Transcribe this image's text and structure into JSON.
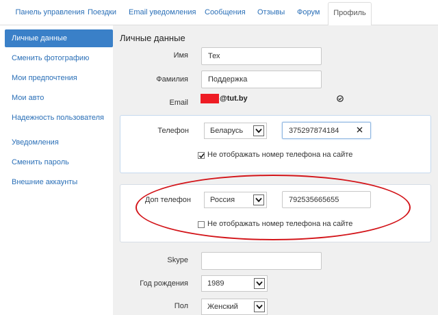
{
  "tabs": [
    {
      "label": "Панель управления"
    },
    {
      "label": "Поездки"
    },
    {
      "label": "Email уведомления"
    },
    {
      "label": "Сообщения"
    },
    {
      "label": "Отзывы"
    },
    {
      "label": "Форум"
    },
    {
      "label": "Профиль",
      "active": true
    }
  ],
  "sidebar": {
    "items": [
      {
        "label": "Личные данные",
        "active": true
      },
      {
        "label": "Сменить фотографию"
      },
      {
        "label": "Мои предпочтения"
      },
      {
        "label": "Мои авто"
      },
      {
        "label": "Надежность пользователя"
      },
      {
        "label": "Уведомления"
      },
      {
        "label": "Сменить пароль"
      },
      {
        "label": "Внешние аккаунты"
      }
    ]
  },
  "form": {
    "title": "Личные данные",
    "first_name_label": "Имя",
    "first_name_value": "Тех",
    "last_name_label": "Фамилия",
    "last_name_value": "Поддержка",
    "email_label": "Email",
    "email_suffix": "@tut.by",
    "phone": {
      "label": "Телефон",
      "country": "Беларусь",
      "number": "375297874184",
      "hide_label": "Не отображать номер телефона на сайте",
      "hide_checked": true
    },
    "extra_phone": {
      "label": "Доп телефон",
      "country": "Россия",
      "number": "792535665655",
      "hide_label": "Не отображать номер телефона на сайте",
      "hide_checked": false
    },
    "skype_label": "Skype",
    "skype_value": "",
    "birth_year_label": "Год рождения",
    "birth_year_value": "1989",
    "gender_label": "Пол",
    "gender_value": "Женский"
  },
  "colors": {
    "accent": "#3a80c8",
    "link": "#2a6fb7",
    "annotation": "#d3151a",
    "redacted": "#ee1c24"
  }
}
